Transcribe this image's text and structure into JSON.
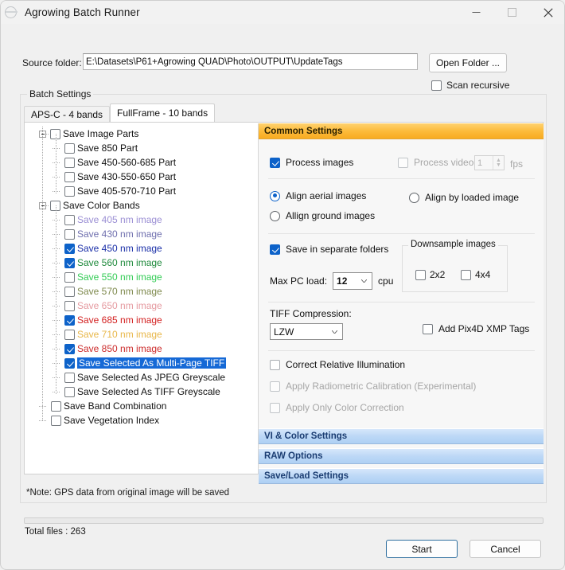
{
  "window": {
    "title": "Agrowing Batch Runner",
    "icon": "agrowing-logo-icon",
    "minimize_label": "minimize-icon",
    "maximize_label": "maximize-icon",
    "close_label": "close-icon"
  },
  "source": {
    "label": "Source folder:",
    "value": "E:\\Datasets\\P61+Agrowing QUAD\\Photo\\OUTPUT\\UpdateTags",
    "placeholder": "",
    "open_folder_button": "Open Folder ...",
    "scan_recursive_label": "Scan recursive",
    "scan_recursive_checked": false
  },
  "batch": {
    "group_title": "Batch Settings",
    "tabs": [
      {
        "label": "APS-C - 4 bands",
        "active": false
      },
      {
        "label": "FullFrame - 10 bands",
        "active": true
      }
    ]
  },
  "tree": {
    "items": [
      {
        "label": "Save Image Parts",
        "level": 0,
        "expander": "minus",
        "checked": false,
        "color": "#111111",
        "selected": false
      },
      {
        "label": "Save 850 Part",
        "level": 1,
        "expander": "none",
        "checked": false,
        "color": "#111111",
        "selected": false
      },
      {
        "label": "Save 450-560-685 Part",
        "level": 1,
        "expander": "none",
        "checked": false,
        "color": "#111111",
        "selected": false
      },
      {
        "label": "Save 430-550-650 Part",
        "level": 1,
        "expander": "none",
        "checked": false,
        "color": "#111111",
        "selected": false
      },
      {
        "label": "Save 405-570-710 Part",
        "level": 1,
        "expander": "none",
        "checked": false,
        "color": "#111111",
        "selected": false
      },
      {
        "label": "Save Color Bands",
        "level": 0,
        "expander": "minus",
        "checked": false,
        "color": "#111111",
        "selected": false
      },
      {
        "label": "Save 405 nm image",
        "level": 1,
        "expander": "none",
        "checked": false,
        "color": "#9b8fd4",
        "selected": false
      },
      {
        "label": "Save 430 nm image",
        "level": 1,
        "expander": "none",
        "checked": false,
        "color": "#6f6fae",
        "selected": false
      },
      {
        "label": "Save 450 nm image",
        "level": 1,
        "expander": "none",
        "checked": true,
        "color": "#1a2fa8",
        "selected": false
      },
      {
        "label": "Save 560 nm image",
        "level": 1,
        "expander": "none",
        "checked": true,
        "color": "#1f8a3c",
        "selected": false
      },
      {
        "label": "Save 550 nm image",
        "level": 1,
        "expander": "none",
        "checked": false,
        "color": "#33cc55",
        "selected": false
      },
      {
        "label": "Save 570 nm image",
        "level": 1,
        "expander": "none",
        "checked": false,
        "color": "#7f8a4e",
        "selected": false
      },
      {
        "label": "Save 650 nm image",
        "level": 1,
        "expander": "none",
        "checked": false,
        "color": "#e59aa0",
        "selected": false
      },
      {
        "label": "Save 685 nm image",
        "level": 1,
        "expander": "none",
        "checked": true,
        "color": "#d32020",
        "selected": false
      },
      {
        "label": "Save 710 nm image",
        "level": 1,
        "expander": "none",
        "checked": false,
        "color": "#e8b74a",
        "selected": false
      },
      {
        "label": "Save 850 nm image",
        "level": 1,
        "expander": "none",
        "checked": true,
        "color": "#cc2b2b",
        "selected": false
      },
      {
        "label": "Save Selected As Multi-Page TIFF",
        "level": 1,
        "expander": "none",
        "checked": true,
        "color": "#111111",
        "selected": true
      },
      {
        "label": "Save Selected As JPEG Greyscale",
        "level": 1,
        "expander": "none",
        "checked": false,
        "color": "#111111",
        "selected": false
      },
      {
        "label": "Save Selected As TIFF Greyscale",
        "level": 1,
        "expander": "none",
        "checked": false,
        "color": "#111111",
        "selected": false
      },
      {
        "label": "Save Band Combination",
        "level": 0,
        "expander": "none",
        "checked": false,
        "color": "#111111",
        "selected": false
      },
      {
        "label": "Save Vegetation Index",
        "level": 0,
        "expander": "none",
        "checked": false,
        "color": "#111111",
        "selected": false
      }
    ]
  },
  "common": {
    "header": "Common Settings",
    "process_images": {
      "label": "Process images",
      "checked": true,
      "disabled": false
    },
    "process_video": {
      "label": "Process video",
      "checked": false,
      "disabled": true
    },
    "fps": {
      "value": "1",
      "unit": "fps",
      "disabled": true
    },
    "align_aerial": {
      "label": "Align aerial images",
      "checked": true
    },
    "align_ground": {
      "label": "Allign ground images",
      "checked": false
    },
    "align_loaded": {
      "label": "Align by loaded image",
      "checked": false
    },
    "save_separate": {
      "label": "Save in separate folders",
      "checked": true
    },
    "max_pc_load_label": "Max PC load:",
    "max_pc_load_value": "12",
    "cpu_unit": "cpu",
    "downsample": {
      "title": "Downsample images",
      "options": [
        {
          "label": "2x2",
          "checked": false
        },
        {
          "label": "4x4",
          "checked": false
        }
      ]
    },
    "tiff_compression_label": "TIFF Compression:",
    "tiff_compression_value": "LZW",
    "add_pix4d": {
      "label": "Add Pix4D XMP Tags",
      "checked": false
    },
    "correct_illumination": {
      "label": "Correct Relative Illumination",
      "checked": false,
      "disabled": false
    },
    "radiometric": {
      "label": "Apply Radiometric Calibration (Experimental)",
      "checked": false,
      "disabled": true
    },
    "color_correction": {
      "label": "Apply Only Color Correction",
      "checked": false,
      "disabled": true
    }
  },
  "sections": [
    {
      "label": "VI & Color Settings"
    },
    {
      "label": "RAW Options"
    },
    {
      "label": "Save/Load Settings"
    }
  ],
  "footer": {
    "note": "*Note: GPS data from original image will be saved",
    "total_files": "Total files : 263",
    "progress_percent": 0,
    "start_button": "Start",
    "cancel_button": "Cancel"
  },
  "colors": {
    "accent_blue": "#0d62c9",
    "section_orange": "#f8ab20",
    "section_blue": "#bdd8f6",
    "selection_blue": "#1569d6"
  }
}
